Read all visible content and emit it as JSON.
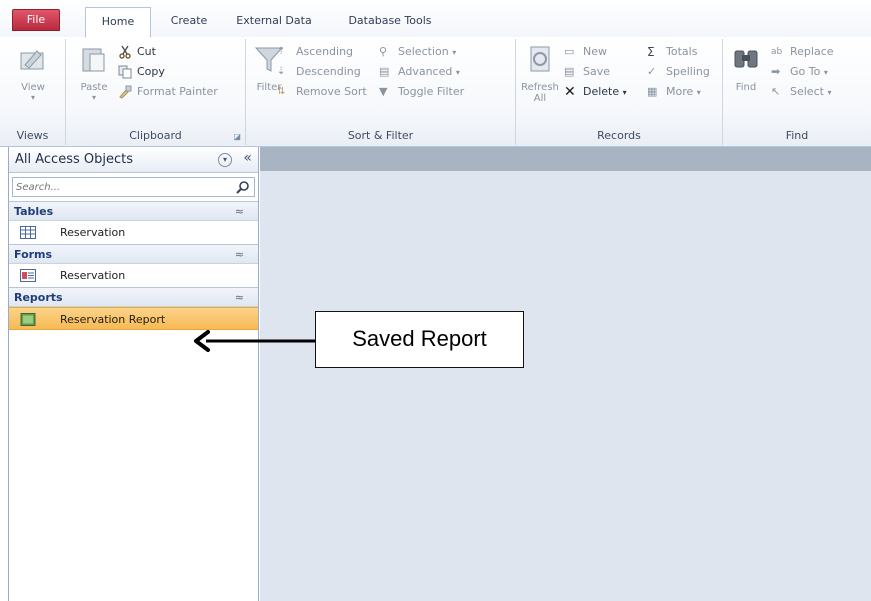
{
  "tabs": {
    "file": "File",
    "home": "Home",
    "create": "Create",
    "external_data": "External Data",
    "database_tools": "Database Tools"
  },
  "ribbon": {
    "views": {
      "label": "Views",
      "view": "View"
    },
    "clipboard": {
      "label": "Clipboard",
      "paste": "Paste",
      "cut": "Cut",
      "copy": "Copy",
      "format_painter": "Format Painter"
    },
    "sort_filter": {
      "label": "Sort & Filter",
      "filter": "Filter",
      "ascending": "Ascending",
      "descending": "Descending",
      "remove_sort": "Remove Sort",
      "selection": "Selection",
      "advanced": "Advanced",
      "toggle_filter": "Toggle Filter"
    },
    "records": {
      "label": "Records",
      "refresh_all": "Refresh All",
      "new": "New",
      "save": "Save",
      "delete": "Delete",
      "totals": "Totals",
      "spelling": "Spelling",
      "more": "More"
    },
    "find": {
      "label": "Find",
      "find": "Find",
      "replace": "Replace",
      "go_to": "Go To",
      "select": "Select"
    }
  },
  "nav": {
    "title": "All Access Objects",
    "search_placeholder": "Search...",
    "sections": {
      "tables": {
        "header": "Tables",
        "item": "Reservation"
      },
      "forms": {
        "header": "Forms",
        "item": "Reservation"
      },
      "reports": {
        "header": "Reports",
        "item": "Reservation Report"
      }
    }
  },
  "callout": {
    "text": "Saved Report"
  },
  "colors": {
    "file_tab": "#c63346",
    "selected_item": "#f8c36a",
    "workspace": "#dee5ef",
    "section_header_text": "#1f3d7a"
  }
}
